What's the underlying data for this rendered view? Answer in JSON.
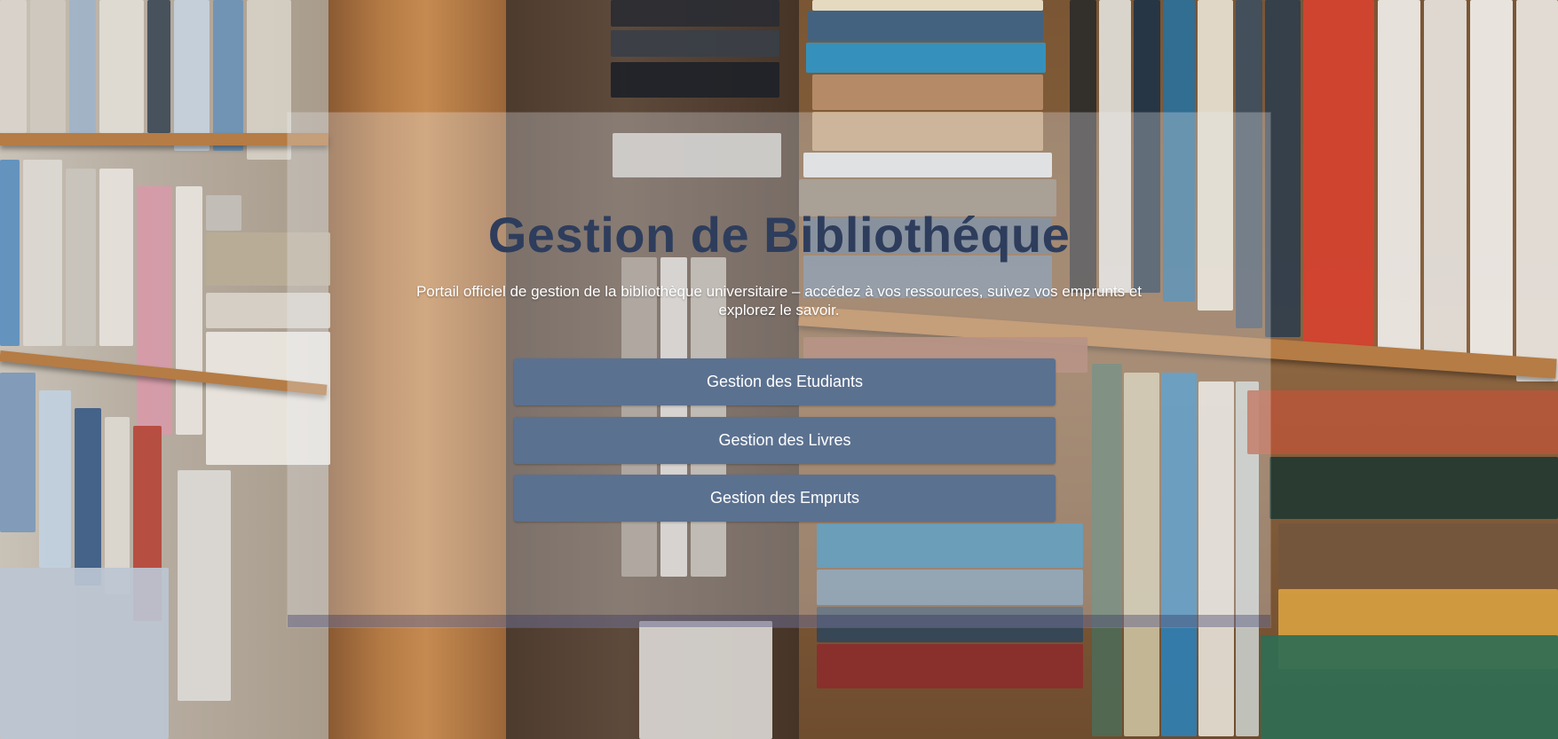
{
  "header": {
    "title": "Gestion de Bibliothéque",
    "subtitle": "Portail officiel de gestion de la bibliothèque universitaire – accédez à vos ressources, suivez vos emprunts et explorez le savoir."
  },
  "menu": {
    "students_label": "Gestion des Etudiants",
    "books_label": "Gestion des Livres",
    "loans_label": "Gestion des Empruts"
  },
  "colors": {
    "title": "#2e3d5c",
    "button": "#5b7190",
    "button_text": "#ffffff"
  }
}
